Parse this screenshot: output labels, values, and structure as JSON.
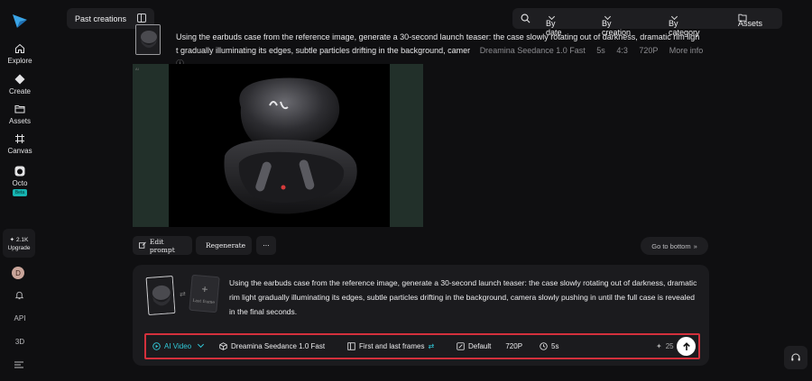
{
  "sidebar": {
    "items": [
      {
        "label": "Explore",
        "icon": "home-icon"
      },
      {
        "label": "Create",
        "icon": "diamond-icon"
      },
      {
        "label": "Assets",
        "icon": "folder-icon"
      },
      {
        "label": "Canvas",
        "icon": "canvas-icon"
      },
      {
        "label": "Octo",
        "icon": "octo-icon",
        "badge": "Beta"
      }
    ],
    "credits": "2.1K",
    "upgrade_label": "Upgrade",
    "avatar_letter": "D",
    "api_label": "API",
    "threed_label": "3D"
  },
  "topbar": {
    "past_creations": "Past creations",
    "by_date": "By date",
    "by_creation": "By creation",
    "by_category": "By category",
    "assets": "Assets"
  },
  "creation": {
    "prompt_line1": "Using the earbuds case from the reference image, generate a 30-second launch teaser: the case slowly rotating out of darkness, dramatic rim ligh",
    "prompt_line2": "t gradually illuminating its edges, subtle particles drifting in the background, camer",
    "model": "Dreamina Seedance 1.0 Fast",
    "duration": "5s",
    "ratio": "4:3",
    "resolution": "720P",
    "more_info": "More info",
    "image_tag": "AI"
  },
  "actions": {
    "edit_prompt": "Edit prompt",
    "regenerate": "Regenerate",
    "more": "···",
    "go_to_bottom": "Go to bottom"
  },
  "prompt_box": {
    "last_frame_label": "Last frame",
    "text": "Using the earbuds case from the reference image, generate a 30-second launch teaser: the case slowly rotating out of darkness, dramatic rim light gradually illuminating its edges, subtle particles drifting in the background, camera slowly pushing in until the full case is revealed in the final seconds."
  },
  "toolbar": {
    "mode": "AI Video",
    "model": "Dreamina Seedance 1.0 Fast",
    "frames": "First and last frames",
    "aspect": "Default",
    "resolution": "720P",
    "duration": "5s",
    "credits": "25"
  },
  "colors": {
    "accent": "#31c9d9",
    "highlight_border": "#d3303c",
    "background": "#0f0f11"
  }
}
